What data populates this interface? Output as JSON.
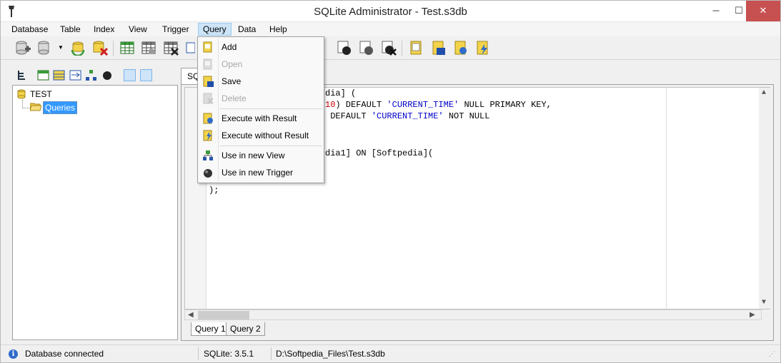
{
  "window": {
    "title": "SQLite Administrator - Test.s3db"
  },
  "menubar": {
    "items": [
      {
        "label": "Database"
      },
      {
        "label": "Table"
      },
      {
        "label": "Index"
      },
      {
        "label": "View"
      },
      {
        "label": "Trigger"
      },
      {
        "label": "Query"
      },
      {
        "label": "Data"
      },
      {
        "label": "Help"
      }
    ],
    "active": "Query"
  },
  "query_menu": {
    "items": [
      {
        "label": "Add",
        "enabled": true,
        "icon": "add-query-icon"
      },
      {
        "label": "Open",
        "enabled": false,
        "icon": "open-query-icon"
      },
      {
        "label": "Save",
        "enabled": true,
        "icon": "save-query-icon"
      },
      {
        "label": "Delete",
        "enabled": false,
        "icon": "delete-query-icon"
      },
      {
        "label": "Execute with Result",
        "enabled": true,
        "icon": "execute-result-icon"
      },
      {
        "label": "Execute without Result",
        "enabled": true,
        "icon": "execute-no-result-icon"
      },
      {
        "label": "Use in new View",
        "enabled": true,
        "icon": "new-view-icon"
      },
      {
        "label": "Use in new Trigger",
        "enabled": true,
        "icon": "new-trigger-icon"
      }
    ]
  },
  "tree": {
    "root": "TEST",
    "child": "Queries"
  },
  "editor": {
    "tab_label": "SQL",
    "lines": [
      {
        "a": "dia] ("
      },
      {
        "a": "10",
        "b": ") DEFAULT ",
        "c": "'CURRENT_TIME'",
        "d": " NULL PRIMARY KEY,"
      },
      {
        "a": " DEFAULT ",
        "b": "'CURRENT_TIME'",
        "c": " NOT NULL"
      },
      {
        "a": "dia1] ON [Softpedia]("
      },
      {
        "a": ");"
      }
    ]
  },
  "bottom_tabs": [
    {
      "label": "Query 1"
    },
    {
      "label": "Query 2"
    }
  ],
  "status": {
    "message": "Database connected",
    "version": "SQLite: 3.5.1",
    "path": "D:\\Softpedia_Files\\Test.s3db"
  },
  "colors": {
    "accent": "#3399ff",
    "string": "#0000c8",
    "number": "#c80000",
    "close": "#c75050"
  }
}
